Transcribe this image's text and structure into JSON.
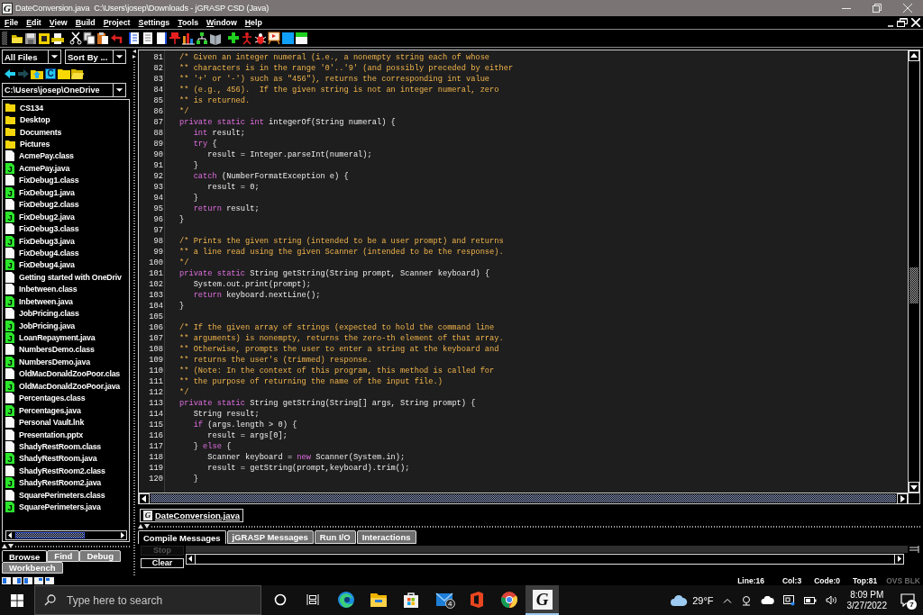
{
  "window": {
    "title": "DateConversion.java  C:\\Users\\josep\\Downloads - jGRASP CSD (Java)",
    "logo_letter": "G"
  },
  "menu": [
    "File",
    "Edit",
    "View",
    "Build",
    "Project",
    "Settings",
    "Tools",
    "Window",
    "Help"
  ],
  "browser": {
    "filter": "All Files",
    "sort": "Sort By ...",
    "path": "C:\\Users\\josep\\OneDrive",
    "navigation": [
      {
        "kind": "back",
        "disabled": false
      },
      {
        "kind": "forward",
        "disabled": true
      },
      {
        "kind": "up",
        "disabled": false
      },
      {
        "kind": "refresh",
        "letter": "C",
        "disabled": false
      },
      {
        "kind": "new_folder",
        "disabled": false
      },
      {
        "kind": "open_folder",
        "disabled": false
      }
    ],
    "files": [
      {
        "name": "CS134",
        "kind": "folder"
      },
      {
        "name": "Desktop",
        "kind": "folder"
      },
      {
        "name": "Documents",
        "kind": "folder"
      },
      {
        "name": "Pictures",
        "kind": "folder"
      },
      {
        "name": "AcmePay.class",
        "kind": "document"
      },
      {
        "name": "AcmePay.java",
        "kind": "java",
        "icon_letter": "J"
      },
      {
        "name": "FixDebug1.class",
        "kind": "document"
      },
      {
        "name": "FixDebug1.java",
        "kind": "java",
        "icon_letter": "J"
      },
      {
        "name": "FixDebug2.class",
        "kind": "document"
      },
      {
        "name": "FixDebug2.java",
        "kind": "java",
        "icon_letter": "J"
      },
      {
        "name": "FixDebug3.class",
        "kind": "document"
      },
      {
        "name": "FixDebug3.java",
        "kind": "java",
        "icon_letter": "J"
      },
      {
        "name": "FixDebug4.class",
        "kind": "document"
      },
      {
        "name": "FixDebug4.java",
        "kind": "java",
        "icon_letter": "J"
      },
      {
        "name": "Getting started with OneDriv",
        "kind": "document"
      },
      {
        "name": "Inbetween.class",
        "kind": "document"
      },
      {
        "name": "Inbetween.java",
        "kind": "java",
        "icon_letter": "J"
      },
      {
        "name": "JobPricing.class",
        "kind": "document"
      },
      {
        "name": "JobPricing.java",
        "kind": "java",
        "icon_letter": "J"
      },
      {
        "name": "LoanRepayment.java",
        "kind": "java",
        "icon_letter": "J"
      },
      {
        "name": "NumbersDemo.class",
        "kind": "document"
      },
      {
        "name": "NumbersDemo.java",
        "kind": "java",
        "icon_letter": "J"
      },
      {
        "name": "OldMacDonaldZooPoor.clas",
        "kind": "document"
      },
      {
        "name": "OldMacDonaldZooPoor.java",
        "kind": "java",
        "icon_letter": "J"
      },
      {
        "name": "Percentages.class",
        "kind": "document"
      },
      {
        "name": "Percentages.java",
        "kind": "java",
        "icon_letter": "J"
      },
      {
        "name": "Personal Vault.lnk",
        "kind": "document"
      },
      {
        "name": "Presentation.pptx",
        "kind": "document"
      },
      {
        "name": "ShadyRestRoom.class",
        "kind": "document"
      },
      {
        "name": "ShadyRestRoom.java",
        "kind": "java",
        "icon_letter": "J"
      },
      {
        "name": "ShadyRestRoom2.class",
        "kind": "document"
      },
      {
        "name": "ShadyRestRoom2.java",
        "kind": "java",
        "icon_letter": "J"
      },
      {
        "name": "SquarePerimeters.class",
        "kind": "document"
      },
      {
        "name": "SquarePerimeters.java",
        "kind": "java",
        "icon_letter": "J"
      }
    ],
    "tabs": [
      [
        {
          "label": "Browse",
          "selected": true
        },
        {
          "label": "Find",
          "selected": false
        },
        {
          "label": "Debug",
          "selected": false
        }
      ],
      [
        {
          "label": "Workbench",
          "selected": false
        }
      ]
    ]
  },
  "editor": {
    "lines": [
      {
        "n": "81",
        "code": [
          {
            "kind": "comment",
            "text": "/* Given an integer numeral (i.e., a nonempty string each of whose"
          }
        ]
      },
      {
        "n": "82",
        "code": [
          {
            "kind": "comment",
            "text": "** characters is in the range '0'..'9' (and possibly preceded by either"
          }
        ]
      },
      {
        "n": "83",
        "code": [
          {
            "kind": "comment",
            "text": "** '+' or '-') such as \"456\"), returns the corresponding int value"
          }
        ]
      },
      {
        "n": "84",
        "code": [
          {
            "kind": "comment",
            "text": "** (e.g., 456).  If the given string is not an integer numeral, zero"
          }
        ]
      },
      {
        "n": "85",
        "code": [
          {
            "kind": "comment",
            "text": "** is returned."
          }
        ]
      },
      {
        "n": "86",
        "code": [
          {
            "kind": "comment",
            "text": "*/"
          }
        ]
      },
      {
        "n": "87",
        "code": [
          {
            "kind": "keyword",
            "text": "private static int"
          },
          {
            "kind": "plain",
            "text": " integerOf(String numeral) {"
          }
        ]
      },
      {
        "n": "88",
        "code": [
          {
            "kind": "keyword",
            "text": "   int"
          },
          {
            "kind": "plain",
            "text": " result;"
          }
        ]
      },
      {
        "n": "89",
        "code": [
          {
            "kind": "keyword",
            "text": "   try"
          },
          {
            "kind": "plain",
            "text": " {"
          }
        ]
      },
      {
        "n": "90",
        "code": [
          {
            "kind": "plain",
            "text": "      result = Integer.parseInt(numeral);"
          }
        ]
      },
      {
        "n": "91",
        "code": [
          {
            "kind": "plain",
            "text": "   }"
          }
        ]
      },
      {
        "n": "92",
        "code": [
          {
            "kind": "keyword",
            "text": "   catch"
          },
          {
            "kind": "plain",
            "text": " (NumberFormatException e) {"
          }
        ]
      },
      {
        "n": "93",
        "code": [
          {
            "kind": "plain",
            "text": "      result = 0;"
          }
        ]
      },
      {
        "n": "94",
        "code": [
          {
            "kind": "plain",
            "text": "   }"
          }
        ]
      },
      {
        "n": "95",
        "code": [
          {
            "kind": "keyword",
            "text": "   return"
          },
          {
            "kind": "plain",
            "text": " result;"
          }
        ]
      },
      {
        "n": "96",
        "code": [
          {
            "kind": "plain",
            "text": "}"
          }
        ]
      },
      {
        "n": "97"
      },
      {
        "n": "98",
        "code": [
          {
            "kind": "comment",
            "text": "/* Prints the given string (intended to be a user prompt) and returns"
          }
        ]
      },
      {
        "n": "99",
        "code": [
          {
            "kind": "comment",
            "text": "** a line read using the given Scanner (intended to be the response)."
          }
        ]
      },
      {
        "n": "100",
        "code": [
          {
            "kind": "comment",
            "text": "*/"
          }
        ]
      },
      {
        "n": "101",
        "code": [
          {
            "kind": "keyword",
            "text": "private static"
          },
          {
            "kind": "plain",
            "text": " String getString(String prompt, Scanner keyboard) {"
          }
        ]
      },
      {
        "n": "102",
        "code": [
          {
            "kind": "plain",
            "text": "   System.out.print(prompt);"
          }
        ]
      },
      {
        "n": "103",
        "code": [
          {
            "kind": "keyword",
            "text": "   return"
          },
          {
            "kind": "plain",
            "text": " keyboard.nextLine();"
          }
        ]
      },
      {
        "n": "104",
        "code": [
          {
            "kind": "plain",
            "text": "}"
          }
        ]
      },
      {
        "n": "105"
      },
      {
        "n": "106",
        "code": [
          {
            "kind": "comment",
            "text": "/* If the given array of strings (expected to hold the command line"
          }
        ]
      },
      {
        "n": "107",
        "code": [
          {
            "kind": "comment",
            "text": "** arguments) is nonempty, returns the zero-th element of that array."
          }
        ]
      },
      {
        "n": "108",
        "code": [
          {
            "kind": "comment",
            "text": "** Otherwise, prompts the user to enter a string at the keyboard and"
          }
        ]
      },
      {
        "n": "109",
        "code": [
          {
            "kind": "comment",
            "text": "** returns the user's (trimmed) response."
          }
        ]
      },
      {
        "n": "110",
        "code": [
          {
            "kind": "comment",
            "text": "** (Note: In the context of this program, this method is called for"
          }
        ]
      },
      {
        "n": "111",
        "code": [
          {
            "kind": "comment",
            "text": "** the purpose of returning the name of the input file.)"
          }
        ]
      },
      {
        "n": "112",
        "code": [
          {
            "kind": "comment",
            "text": "*/"
          }
        ]
      },
      {
        "n": "113",
        "code": [
          {
            "kind": "keyword",
            "text": "private static"
          },
          {
            "kind": "plain",
            "text": " String getString(String[] args, String prompt) {"
          }
        ]
      },
      {
        "n": "114",
        "code": [
          {
            "kind": "plain",
            "text": "   String result;"
          }
        ]
      },
      {
        "n": "115",
        "code": [
          {
            "kind": "keyword",
            "text": "   if"
          },
          {
            "kind": "plain",
            "text": " (args.length > 0) {"
          }
        ]
      },
      {
        "n": "116",
        "code": [
          {
            "kind": "plain",
            "text": "      result = args[0];"
          }
        ]
      },
      {
        "n": "117",
        "code": [
          {
            "kind": "plain",
            "text": "   } "
          },
          {
            "kind": "keyword",
            "text": "else"
          },
          {
            "kind": "plain",
            "text": " {"
          }
        ]
      },
      {
        "n": "118",
        "code": [
          {
            "kind": "plain",
            "text": "      Scanner keyboard = "
          },
          {
            "kind": "keyword",
            "text": "new"
          },
          {
            "kind": "plain",
            "text": " Scanner(System.in);"
          }
        ]
      },
      {
        "n": "119",
        "code": [
          {
            "kind": "plain",
            "text": "      result = getString(prompt,keyboard).trim();"
          }
        ]
      },
      {
        "n": "120",
        "code": [
          {
            "kind": "plain",
            "text": "   }"
          }
        ]
      }
    ]
  },
  "document_tabs": [
    {
      "label": "DateConversion.java",
      "logo_letter": "G",
      "selected": true
    }
  ],
  "messages": {
    "tabs": [
      {
        "label": "Compile Messages",
        "selected": true
      },
      {
        "label": "jGRASP Messages",
        "selected": false
      },
      {
        "label": "Run I/O",
        "selected": false
      },
      {
        "label": "Interactions",
        "selected": false
      }
    ],
    "buttons": [
      {
        "label": "Stop",
        "disabled": true
      },
      {
        "label": "Clear",
        "disabled": false
      }
    ]
  },
  "status_bar": {
    "fields": [
      "Line:16",
      "Col:3",
      "Code:0",
      "Top:81"
    ],
    "mode": {
      "label": "OVS BLK",
      "active": false
    }
  },
  "taskbar": {
    "search": {
      "placeholder": "Type here to search"
    },
    "apps": [
      {
        "kind": "cortana",
        "selected": false
      },
      {
        "kind": "task_view",
        "selected": false
      },
      {
        "kind": "edge",
        "selected": false
      },
      {
        "kind": "explorer",
        "selected": false
      },
      {
        "kind": "store",
        "selected": false
      },
      {
        "kind": "mail",
        "badge": "4",
        "selected": false
      },
      {
        "kind": "office",
        "selected": false
      },
      {
        "kind": "chrome",
        "selected": false
      },
      {
        "kind": "jgrasp",
        "letter": "G",
        "selected": true
      }
    ],
    "weather": "29°F",
    "time": "8:09 PM",
    "date": "3/27/2022",
    "notifications": "7"
  }
}
